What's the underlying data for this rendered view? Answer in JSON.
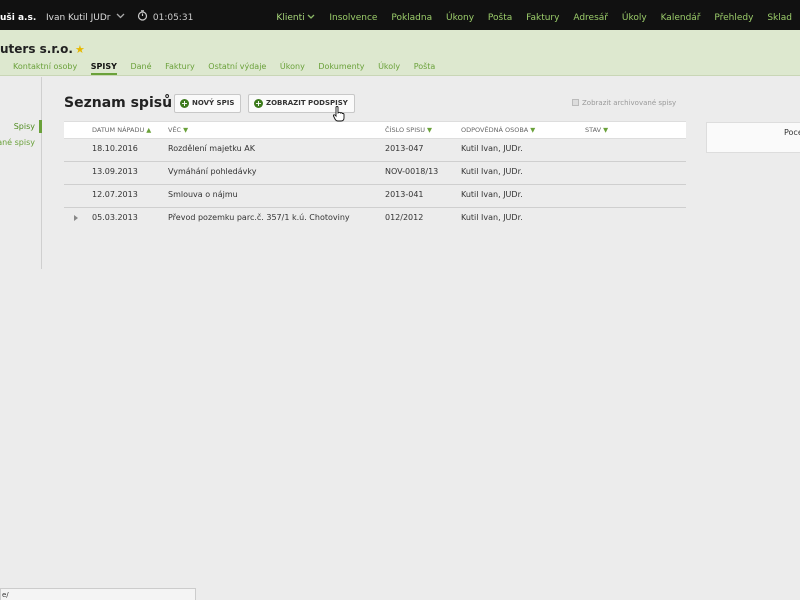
{
  "topbar": {
    "company": "uši a.s.",
    "user": "Ivan Kutil JUDr",
    "timer": "01:05:31",
    "nav": [
      "Klienti",
      "Insolvence",
      "Pokladna",
      "Úkony",
      "Pošta",
      "Faktury",
      "Adresář",
      "Úkoly",
      "Kalendář",
      "Přehledy",
      "Sklad"
    ]
  },
  "client": {
    "name": "uters s.r.o.",
    "tabs": [
      "Kontaktní osoby",
      "SPISY",
      "Dané",
      "Faktury",
      "Ostatní výdaje",
      "Úkony",
      "Dokumenty",
      "Úkoly",
      "Pošta"
    ],
    "active_tab": "SPISY"
  },
  "sidebar": {
    "items": [
      "Spisy",
      "ané spisy"
    ]
  },
  "main": {
    "title": "Seznam spisů",
    "new_button": "NOVÝ SPIS",
    "show_button": "ZOBRAZIT PODSPISY",
    "archive_label": "Zobrazit archivované spisy"
  },
  "table": {
    "columns": [
      "DATUM NÁPADU",
      "VĚC",
      "ČÍSLO SPISU",
      "ODPOVĚDNÁ OSOBA",
      "STAV"
    ],
    "rows": [
      {
        "date": "18.10.2016",
        "matter": "Rozdělení majetku AK",
        "number": "2013-047",
        "person": "Kutil Ivan, JUDr.",
        "state": "",
        "expandable": false
      },
      {
        "date": "13.09.2013",
        "matter": "Vymáhání pohledávky",
        "number": "NOV-0018/13",
        "person": "Kutil Ivan, JUDr.",
        "state": "",
        "expandable": false
      },
      {
        "date": "12.07.2013",
        "matter": "Smlouva o nájmu",
        "number": "2013-041",
        "person": "Kutil Ivan, JUDr.",
        "state": "",
        "expandable": false
      },
      {
        "date": "05.03.2013",
        "matter": "Převod pozemku parc.č. 357/1 k.ú. Chotoviny",
        "number": "012/2012",
        "person": "Kutil Ivan, JUDr.",
        "state": "",
        "expandable": true
      }
    ]
  },
  "right_card": {
    "text": "Pocet"
  },
  "status_bar": {
    "text": "e/"
  },
  "colors": {
    "accent": "#6aa13a",
    "topbar": "#111111",
    "client_bar": "#dde8cf"
  }
}
